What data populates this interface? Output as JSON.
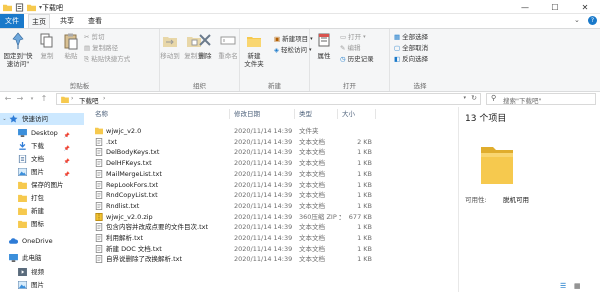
{
  "window": {
    "title": "下载吧",
    "controls": {
      "minimize": "—",
      "maximize": "☐",
      "close": "✕"
    },
    "help": "?"
  },
  "ribbon_tabs": [
    {
      "label": "文件"
    },
    {
      "label": "主页"
    },
    {
      "label": "共享"
    },
    {
      "label": "查看"
    }
  ],
  "ribbon": {
    "clipboard": {
      "pin": "固定到\"快\n速访问\"",
      "copy": "复制",
      "paste": "粘贴",
      "cut": "剪切",
      "copy_path": "复制路径",
      "paste_shortcut": "粘贴快捷方式",
      "group": "剪贴板"
    },
    "organize": {
      "move_to": "移动到",
      "copy_to": "复制到",
      "delete": "删除",
      "rename": "重命名",
      "group": "组织"
    },
    "new": {
      "new_folder": "新建\n文件夹",
      "new_item": "新建项目",
      "easy_access": "轻松访问",
      "group": "新建"
    },
    "open": {
      "properties": "属性",
      "open": "打开",
      "edit": "编辑",
      "history": "历史记录",
      "group": "打开"
    },
    "select": {
      "select_all": "全部选择",
      "select_none": "全部取消",
      "invert": "反向选择",
      "group": "选择"
    }
  },
  "address": {
    "path": "下载吧",
    "search_placeholder": "搜索\"下载吧\""
  },
  "nav": [
    {
      "label": "快速访问",
      "icon": "star-icon",
      "pinned": false,
      "selected": true
    },
    {
      "label": "Desktop",
      "icon": "desktop-icon",
      "pinned": true,
      "selected": false
    },
    {
      "label": "下载",
      "icon": "download-icon",
      "pinned": true,
      "selected": false
    },
    {
      "label": "文档",
      "icon": "documents-icon",
      "pinned": true,
      "selected": false
    },
    {
      "label": "图片",
      "icon": "pictures-icon",
      "pinned": true,
      "selected": false
    },
    {
      "label": "保存的图片",
      "icon": "folder-icon",
      "pinned": false,
      "selected": false
    },
    {
      "label": "打包",
      "icon": "folder-icon",
      "pinned": false,
      "selected": false
    },
    {
      "label": "新建",
      "icon": "folder-icon",
      "pinned": false,
      "selected": false
    },
    {
      "label": "图标",
      "icon": "folder-icon",
      "pinned": false,
      "selected": false
    },
    {
      "label": "OneDrive",
      "icon": "cloud-icon",
      "pinned": false,
      "selected": false
    },
    {
      "label": "此电脑",
      "icon": "computer-icon",
      "pinned": false,
      "selected": false
    },
    {
      "label": "视频",
      "icon": "videos-icon",
      "pinned": false,
      "selected": false
    },
    {
      "label": "图片",
      "icon": "pictures-icon",
      "pinned": false,
      "selected": false
    }
  ],
  "columns": {
    "name": "名称",
    "modified": "修改日期",
    "type": "类型",
    "size": "大小"
  },
  "files": [
    {
      "name": "wjwjc_v2.0",
      "modified": "2020/11/14 14:39",
      "type": "文件夹",
      "size": "",
      "icon": "folder-icon"
    },
    {
      "name": ".txt",
      "modified": "2020/11/14 14:39",
      "type": "文本文档",
      "size": "2 KB",
      "icon": "text-file-icon"
    },
    {
      "name": "DelBodyKeys.txt",
      "modified": "2020/11/14 14:39",
      "type": "文本文档",
      "size": "1 KB",
      "icon": "text-file-icon"
    },
    {
      "name": "DelHFKeys.txt",
      "modified": "2020/11/14 14:39",
      "type": "文本文档",
      "size": "1 KB",
      "icon": "text-file-icon"
    },
    {
      "name": "MailMergeList.txt",
      "modified": "2020/11/14 14:39",
      "type": "文本文档",
      "size": "1 KB",
      "icon": "text-file-icon"
    },
    {
      "name": "RepLookFors.txt",
      "modified": "2020/11/14 14:39",
      "type": "文本文档",
      "size": "1 KB",
      "icon": "text-file-icon"
    },
    {
      "name": "RndCopyList.txt",
      "modified": "2020/11/14 14:39",
      "type": "文本文档",
      "size": "1 KB",
      "icon": "text-file-icon"
    },
    {
      "name": "Rndlist.txt",
      "modified": "2020/11/14 14:39",
      "type": "文本文档",
      "size": "1 KB",
      "icon": "text-file-icon"
    },
    {
      "name": "wjwjc_v2.0.zip",
      "modified": "2020/11/14 14:39",
      "type": "360压缩 ZIP 文件",
      "size": "677 KB",
      "icon": "zip-file-icon"
    },
    {
      "name": "包含内容并改成点要的文件目次.txt",
      "modified": "2020/11/14 14:39",
      "type": "文本文档",
      "size": "1 KB",
      "icon": "text-file-icon"
    },
    {
      "name": "利用解析.txt",
      "modified": "2020/11/14 14:39",
      "type": "文本文档",
      "size": "1 KB",
      "icon": "text-file-icon"
    },
    {
      "name": "新建 DOC 文档.txt",
      "modified": "2020/11/14 14:39",
      "type": "文本文档",
      "size": "1 KB",
      "icon": "text-file-icon"
    },
    {
      "name": "自界说删除了改换解析.txt",
      "modified": "2020/11/14 14:39",
      "type": "文本文档",
      "size": "1 KB",
      "icon": "text-file-icon"
    }
  ],
  "preview": {
    "count": "13 个项目",
    "avail_label": "可用性:",
    "avail_value": "脱机可用"
  },
  "colors": {
    "accent": "#1979ca",
    "folder": "#f6c94e",
    "selected_nav": "#cce8ff"
  }
}
